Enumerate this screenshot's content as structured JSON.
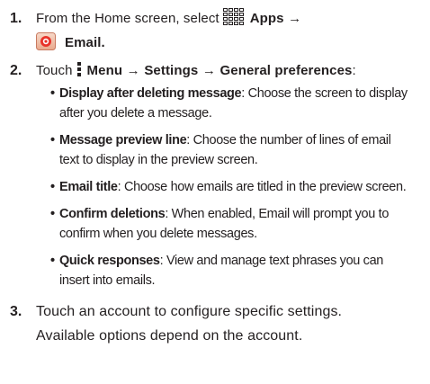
{
  "steps": [
    {
      "number": "1.",
      "line1_prefix": "From the Home screen, select",
      "apps_label": "Apps",
      "arrow": "→",
      "email_label": "Email."
    },
    {
      "number": "2.",
      "prefix": "Touch",
      "menu_label": "Menu",
      "arrow1": "→",
      "settings_label": "Settings",
      "arrow2": "→",
      "general_label": "General preferences",
      "colon": ":",
      "bullets": [
        {
          "term": "Display after deleting message",
          "line1": ": Choose the screen to display",
          "line2": "after you delete a message."
        },
        {
          "term": "Message preview line",
          "line1": ": Choose the number of lines of email",
          "line2": "text to display in the preview screen."
        },
        {
          "term": "Email title",
          "line1": ": Choose how emails are titled in the preview screen.",
          "line2": ""
        },
        {
          "term": "Confirm deletions",
          "line1": ": When enabled, Email will prompt you to",
          "line2": "confirm when you delete messages."
        },
        {
          "term": "Quick responses",
          "line1": ": View and manage text phrases you can",
          "line2": "insert into emails."
        }
      ]
    },
    {
      "number": "3.",
      "line1": "Touch an account to configure specific settings.",
      "line2": "Available options depend on the account."
    }
  ],
  "icons": {
    "apps": "apps-grid-icon",
    "email": "email-app-icon",
    "menu": "menu-dots-icon"
  },
  "colors": {
    "text": "#231f20",
    "email_icon_red": "#e8332a"
  }
}
